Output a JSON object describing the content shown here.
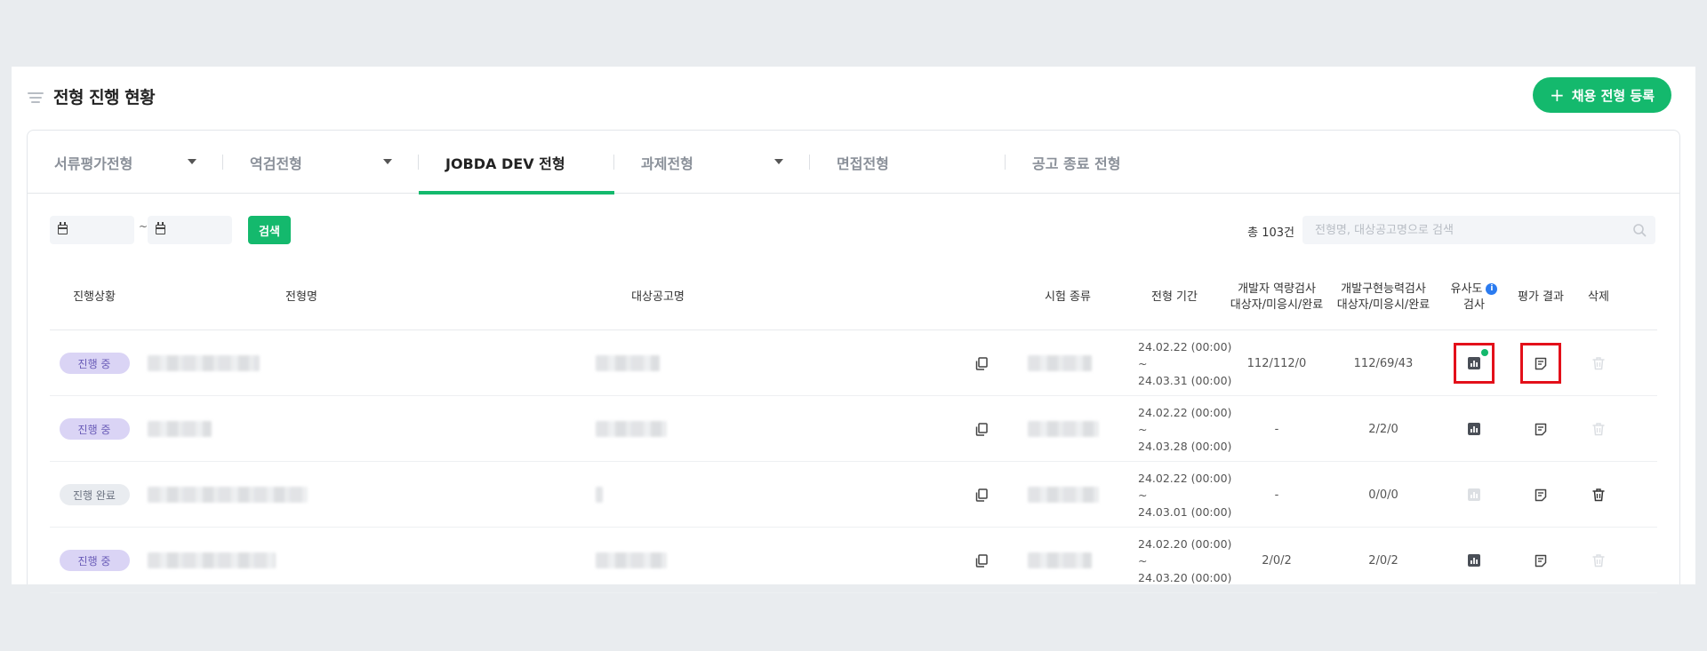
{
  "page": {
    "title": "전형 진행 현황",
    "register_label": "채용 전형 등록"
  },
  "tabs": [
    {
      "label": "서류평가전형",
      "has_dropdown": true,
      "active": false
    },
    {
      "label": "역검전형",
      "has_dropdown": true,
      "active": false
    },
    {
      "label": "JOBDA DEV 전형",
      "has_dropdown": false,
      "active": true
    },
    {
      "label": "과제전형",
      "has_dropdown": true,
      "active": false
    },
    {
      "label": "면접전형",
      "has_dropdown": false,
      "active": false
    },
    {
      "label": "공고 종료 전형",
      "has_dropdown": false,
      "active": false
    }
  ],
  "filter": {
    "date_separator": "~",
    "search_button": "검색",
    "total_count": "총 103건",
    "search_placeholder": "전형명, 대상공고명으로 검색"
  },
  "table": {
    "headers": {
      "status": "진행상황",
      "name": "전형명",
      "posting": "대상공고명",
      "exam_type": "시험 종류",
      "period": "전형 기간",
      "dev_competency_1": "개발자 역량검사",
      "dev_competency_2": "대상자/미응시/완료",
      "dev_skill_1": "개발구현능력검사",
      "dev_skill_2": "대상자/미응시/완료",
      "similarity_1": "유사도",
      "similarity_2": "검사",
      "result": "평가 결과",
      "delete": "삭제"
    },
    "rows": [
      {
        "status": "진행 중",
        "status_type": "progress",
        "period_start": "24.02.22 (00:00) ~",
        "period_end": "24.03.31 (00:00)",
        "dev_competency": "112/112/0",
        "dev_skill": "112/69/43",
        "similarity_enabled": true,
        "similarity_new": true,
        "delete_enabled": false,
        "highlight": true
      },
      {
        "status": "진행 중",
        "status_type": "progress",
        "period_start": "24.02.22 (00:00) ~",
        "period_end": "24.03.28 (00:00)",
        "dev_competency": "-",
        "dev_skill": "2/2/0",
        "similarity_enabled": true,
        "similarity_new": false,
        "delete_enabled": false,
        "highlight": false
      },
      {
        "status": "진행 완료",
        "status_type": "done",
        "period_start": "24.02.22 (00:00) ~",
        "period_end": "24.03.01 (00:00)",
        "dev_competency": "-",
        "dev_skill": "0/0/0",
        "similarity_enabled": false,
        "similarity_new": false,
        "delete_enabled": true,
        "highlight": false
      },
      {
        "status": "진행 중",
        "status_type": "progress",
        "period_start": "24.02.20 (00:00) ~",
        "period_end": "24.03.20 (00:00)",
        "dev_competency": "2/0/2",
        "dev_skill": "2/0/2",
        "similarity_enabled": true,
        "similarity_new": false,
        "delete_enabled": false,
        "highlight": false
      }
    ]
  },
  "colors": {
    "accent": "#14b96d",
    "highlight": "#e3101a",
    "badge_progress": "#dad4f5",
    "badge_done": "#e9ecf0"
  },
  "icons": {
    "menu": "menu-lines-icon",
    "calendar": "calendar-icon",
    "search": "search-icon",
    "copy": "copy-icon",
    "similarity": "bar-chart-icon",
    "result": "document-icon",
    "delete": "trash-icon",
    "info": "info-icon"
  }
}
